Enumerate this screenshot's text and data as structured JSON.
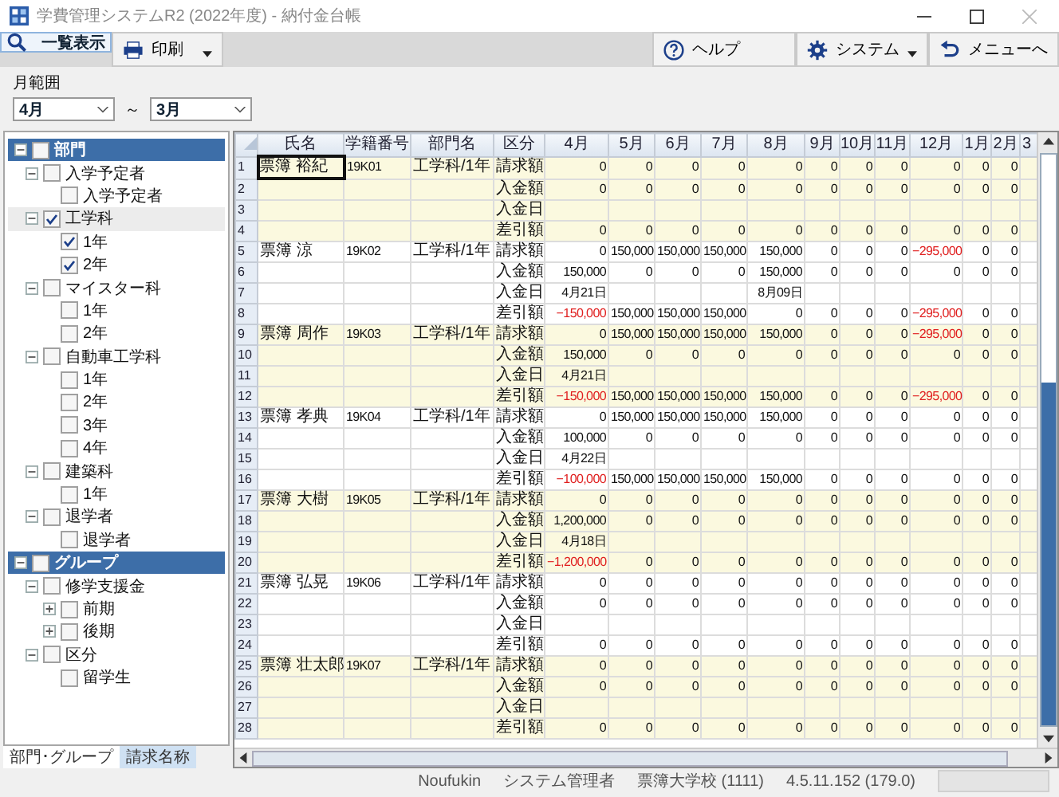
{
  "window": {
    "title": "学費管理システムR2 (2022年度) - 納付金台帳"
  },
  "toolbar": {
    "left": [
      {
        "label": "一覧表示",
        "kind": "search",
        "selected": true,
        "dropdown": false
      },
      {
        "label": "印刷",
        "kind": "print",
        "selected": false,
        "dropdown": true
      }
    ],
    "right": [
      {
        "label": "ヘルプ",
        "kind": "help",
        "selected": false,
        "dropdown": false
      },
      {
        "label": "システム",
        "kind": "gear",
        "selected": false,
        "dropdown": true
      },
      {
        "label": "メニューへ",
        "kind": "back",
        "selected": false,
        "dropdown": false
      }
    ]
  },
  "month_range": {
    "label": "月範囲",
    "from": "4月",
    "separator": "～",
    "to": "3月"
  },
  "tree": {
    "items": [
      {
        "label": "部門",
        "checked": false,
        "expanded": true,
        "selected": false,
        "children": [
          {
            "label": "入学予定者",
            "checked": false,
            "expanded": true,
            "selected": false,
            "children": [
              {
                "label": "入学予定者",
                "checked": false,
                "selected": false
              }
            ]
          },
          {
            "label": "工学科",
            "checked": true,
            "expanded": true,
            "selected": true,
            "children": [
              {
                "label": "1年",
                "checked": true,
                "selected": false
              },
              {
                "label": "2年",
                "checked": true,
                "selected": false
              }
            ]
          },
          {
            "label": "マイスター科",
            "checked": false,
            "expanded": true,
            "selected": false,
            "children": [
              {
                "label": "1年",
                "checked": false,
                "selected": false
              },
              {
                "label": "2年",
                "checked": false,
                "selected": false
              }
            ]
          },
          {
            "label": "自動車工学科",
            "checked": false,
            "expanded": true,
            "selected": false,
            "children": [
              {
                "label": "1年",
                "checked": false,
                "selected": false
              },
              {
                "label": "2年",
                "checked": false,
                "selected": false
              },
              {
                "label": "3年",
                "checked": false,
                "selected": false
              },
              {
                "label": "4年",
                "checked": false,
                "selected": false
              }
            ]
          },
          {
            "label": "建築科",
            "checked": false,
            "expanded": true,
            "selected": false,
            "children": [
              {
                "label": "1年",
                "checked": false,
                "selected": false
              }
            ]
          },
          {
            "label": "退学者",
            "checked": false,
            "expanded": true,
            "selected": false,
            "children": [
              {
                "label": "退学者",
                "checked": false,
                "selected": false
              }
            ]
          }
        ]
      },
      {
        "label": "グループ",
        "checked": false,
        "expanded": true,
        "selected": false,
        "children": [
          {
            "label": "修学支援金",
            "checked": false,
            "expanded": true,
            "selected": false,
            "children": [
              {
                "label": "前期",
                "checked": false,
                "expanded": false,
                "selected": false
              },
              {
                "label": "後期",
                "checked": false,
                "expanded": false,
                "selected": false
              }
            ]
          },
          {
            "label": "区分",
            "checked": false,
            "expanded": true,
            "selected": false,
            "children": [
              {
                "label": "留学生",
                "checked": false,
                "selected": false
              }
            ]
          }
        ]
      }
    ]
  },
  "tree_tabs": [
    {
      "label": "部門･グループ",
      "selected": true
    },
    {
      "label": "請求名称",
      "selected": false
    }
  ],
  "table": {
    "columns": [
      "氏名",
      "学籍番号",
      "部門名",
      "区分",
      "4月",
      "5月",
      "6月",
      "7月",
      "8月",
      "9月",
      "10月",
      "11月",
      "12月",
      "1月",
      "2月",
      "3"
    ],
    "rows": [
      {
        "no": "1",
        "name": "票簿 裕紀",
        "student_id": "19K01",
        "department": "工学科/1年",
        "category": "請求額",
        "selected": true,
        "months": [
          "0",
          "0",
          "0",
          "0",
          "0",
          "0",
          "0",
          "0",
          "0",
          "0",
          "0"
        ]
      },
      {
        "no": "2",
        "category": "入金額",
        "selected": false,
        "months": [
          "0",
          "0",
          "0",
          "0",
          "0",
          "0",
          "0",
          "0",
          "0",
          "0",
          "0"
        ]
      },
      {
        "no": "3",
        "category": "入金日",
        "selected": false
      },
      {
        "no": "4",
        "category": "差引額",
        "selected": false,
        "months": [
          "0",
          "0",
          "0",
          "0",
          "0",
          "0",
          "0",
          "0",
          "0",
          "0",
          "0"
        ]
      },
      {
        "no": "5",
        "name": "票簿 涼",
        "student_id": "19K02",
        "department": "工学科/1年",
        "category": "請求額",
        "selected": false,
        "months": [
          "0",
          "150,000",
          "150,000",
          "150,000",
          "150,000",
          "0",
          "0",
          "0",
          {
            "value": "−295,000",
            "negative": true
          },
          "0",
          "0"
        ]
      },
      {
        "no": "6",
        "category": "入金額",
        "selected": false,
        "months": [
          "150,000",
          "0",
          "0",
          "0",
          "150,000",
          "0",
          "0",
          "0",
          "0",
          "0",
          "0"
        ]
      },
      {
        "no": "7",
        "category": "入金日",
        "selected": false,
        "months": {
          "apr": "4月21日",
          "aug": "8月09日"
        }
      },
      {
        "no": "8",
        "category": "差引額",
        "selected": false,
        "months": [
          {
            "value": "−150,000",
            "negative": true
          },
          "150,000",
          "150,000",
          "150,000",
          "0",
          "0",
          "0",
          "0",
          {
            "value": "−295,000",
            "negative": true
          },
          "0",
          "0"
        ]
      },
      {
        "no": "9",
        "name": "票簿 周作",
        "student_id": "19K03",
        "department": "工学科/1年",
        "category": "請求額",
        "selected": false,
        "months": [
          "0",
          "150,000",
          "150,000",
          "150,000",
          "150,000",
          "0",
          "0",
          "0",
          {
            "value": "−295,000",
            "negative": true
          },
          "0",
          "0"
        ]
      },
      {
        "no": "10",
        "category": "入金額",
        "selected": false,
        "months": [
          "150,000",
          "0",
          "0",
          "0",
          "0",
          "0",
          "0",
          "0",
          "0",
          "0",
          "0"
        ]
      },
      {
        "no": "11",
        "category": "入金日",
        "selected": false,
        "months": [
          "4月21日"
        ]
      },
      {
        "no": "12",
        "category": "差引額",
        "selected": false,
        "months": [
          {
            "value": "−150,000",
            "negative": true
          },
          "150,000",
          "150,000",
          "150,000",
          "150,000",
          "0",
          "0",
          "0",
          {
            "value": "−295,000",
            "negative": true
          },
          "0",
          "0"
        ]
      },
      {
        "no": "13",
        "name": "票簿 孝典",
        "student_id": "19K04",
        "department": "工学科/1年",
        "category": "請求額",
        "selected": false,
        "months": [
          "0",
          "150,000",
          "150,000",
          "150,000",
          "150,000",
          "0",
          "0",
          "0",
          "0",
          "0",
          "0"
        ]
      },
      {
        "no": "14",
        "category": "入金額",
        "selected": false,
        "months": [
          "100,000",
          "0",
          "0",
          "0",
          "0",
          "0",
          "0",
          "0",
          "0",
          "0",
          "0"
        ]
      },
      {
        "no": "15",
        "category": "入金日",
        "selected": false,
        "months": [
          "4月22日"
        ]
      },
      {
        "no": "16",
        "category": "差引額",
        "selected": false,
        "months": [
          {
            "value": "−100,000",
            "negative": true
          },
          "150,000",
          "150,000",
          "150,000",
          "150,000",
          "0",
          "0",
          "0",
          "0",
          "0",
          "0"
        ]
      },
      {
        "no": "17",
        "name": "票簿 大樹",
        "student_id": "19K05",
        "department": "工学科/1年",
        "category": "請求額",
        "selected": false,
        "months": [
          "0",
          "0",
          "0",
          "0",
          "0",
          "0",
          "0",
          "0",
          "0",
          "0",
          "0"
        ]
      },
      {
        "no": "18",
        "category": "入金額",
        "selected": false,
        "months": [
          "1,200,000",
          "0",
          "0",
          "0",
          "0",
          "0",
          "0",
          "0",
          "0",
          "0",
          "0"
        ]
      },
      {
        "no": "19",
        "category": "入金日",
        "selected": false,
        "months": [
          "4月18日"
        ]
      },
      {
        "no": "20",
        "category": "差引額",
        "selected": false,
        "months": [
          {
            "value": "−1,200,000",
            "negative": true
          },
          "0",
          "0",
          "0",
          "0",
          "0",
          "0",
          "0",
          "0",
          "0",
          "0"
        ]
      },
      {
        "no": "21",
        "name": "票簿 弘晃",
        "student_id": "19K06",
        "department": "工学科/1年",
        "category": "請求額",
        "selected": false,
        "months": [
          "0",
          "0",
          "0",
          "0",
          "0",
          "0",
          "0",
          "0",
          "0",
          "0",
          "0"
        ]
      },
      {
        "no": "22",
        "category": "入金額",
        "selected": false,
        "months": [
          "0",
          "0",
          "0",
          "0",
          "0",
          "0",
          "0",
          "0",
          "0",
          "0",
          "0"
        ]
      },
      {
        "no": "23",
        "category": "入金日",
        "selected": false
      },
      {
        "no": "24",
        "category": "差引額",
        "selected": false,
        "months": [
          "0",
          "0",
          "0",
          "0",
          "0",
          "0",
          "0",
          "0",
          "0",
          "0",
          "0"
        ]
      },
      {
        "no": "25",
        "name": "票簿 壮太郎",
        "student_id": "19K07",
        "department": "工学科/1年",
        "category": "請求額",
        "selected": false,
        "months": [
          "0",
          "0",
          "0",
          "0",
          "0",
          "0",
          "0",
          "0",
          "0",
          "0",
          "0"
        ]
      },
      {
        "no": "26",
        "category": "入金額",
        "selected": false,
        "months": [
          "0",
          "0",
          "0",
          "0",
          "0",
          "0",
          "0",
          "0",
          "0",
          "0",
          "0"
        ]
      },
      {
        "no": "27",
        "category": "入金日",
        "selected": false
      },
      {
        "no": "28",
        "category": "差引額",
        "selected": false,
        "months": [
          "0",
          "0",
          "0",
          "0",
          "0",
          "0",
          "0",
          "0",
          "0",
          "0",
          "0"
        ]
      }
    ]
  },
  "status_bar": [
    "Noufukin",
    "システム管理者",
    "票簿大学校 (1111)",
    "4.5.11.152 (179.0)"
  ]
}
